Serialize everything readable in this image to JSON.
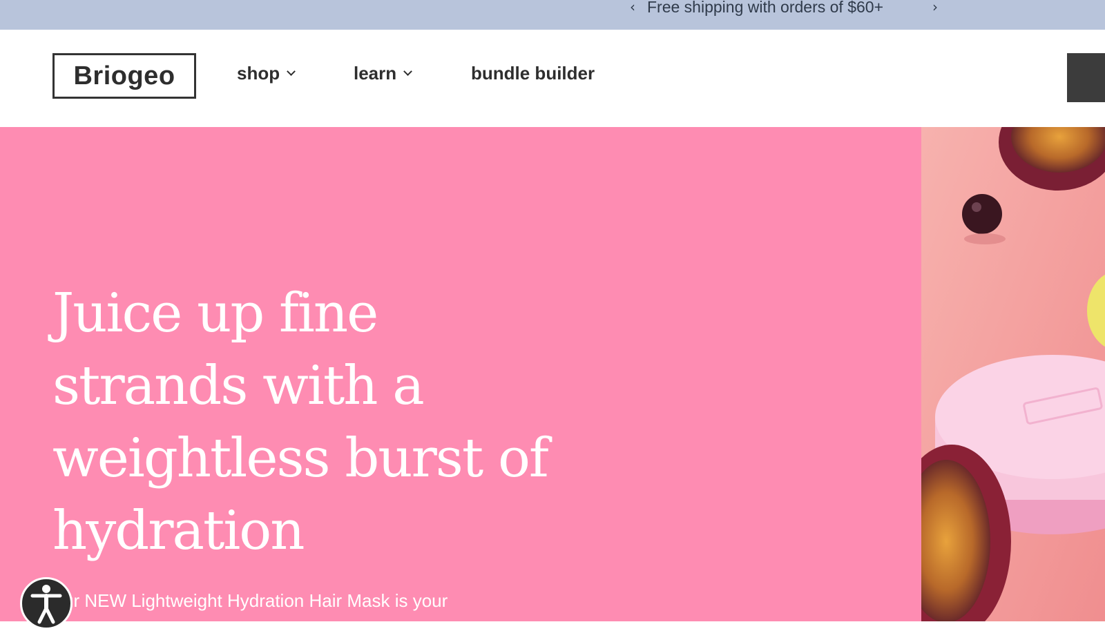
{
  "announcement": {
    "text": "Free shipping with orders of $60+",
    "prev_glyph": "‹",
    "next_glyph": "›"
  },
  "header": {
    "logo": "Briogeo",
    "nav": [
      {
        "label": "shop",
        "has_dropdown": true
      },
      {
        "label": "learn",
        "has_dropdown": true
      },
      {
        "label": "bundle builder",
        "has_dropdown": false
      }
    ]
  },
  "hero": {
    "title": "Juice up fine strands with a weightless burst of hydration",
    "subtitle_visible": "ur NEW Lightweight Hydration Hair Mask is your",
    "background_color": "#fe8cb2",
    "image": "product photo of pink hair mask jar with passion fruit"
  },
  "accessibility": {
    "icon": "accessibility-icon"
  },
  "colors": {
    "announcement_bg": "#b8c4db",
    "hero_pink": "#fe8cb2",
    "text_dark": "#2e2e2e"
  }
}
